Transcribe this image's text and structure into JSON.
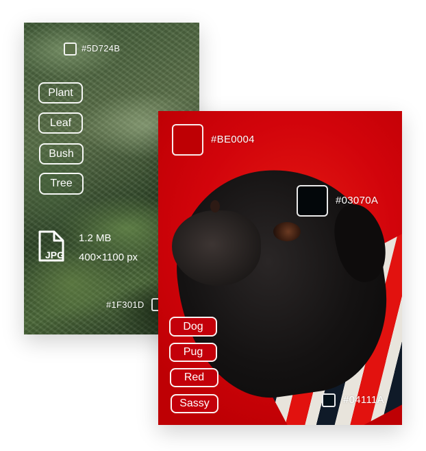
{
  "cards": {
    "plant": {
      "palette": [
        {
          "hex": "#5D724B",
          "color": "#5D724B"
        },
        {
          "hex": "#1F301D",
          "color": "#1F301D"
        }
      ],
      "tags": [
        "Plant",
        "Leaf",
        "Bush",
        "Tree"
      ],
      "file": {
        "icon": "jpg-file-icon",
        "format": "JPG",
        "size": "1.2 MB",
        "dimensions": "400×1100 px"
      }
    },
    "pug": {
      "palette": [
        {
          "hex": "#BE0004",
          "color": "#BE0004"
        },
        {
          "hex": "#03070A",
          "color": "#03070A"
        },
        {
          "hex": "#04111A",
          "color": "#04111A"
        }
      ],
      "tags": [
        "Dog",
        "Pug",
        "Red",
        "Sassy"
      ]
    }
  }
}
